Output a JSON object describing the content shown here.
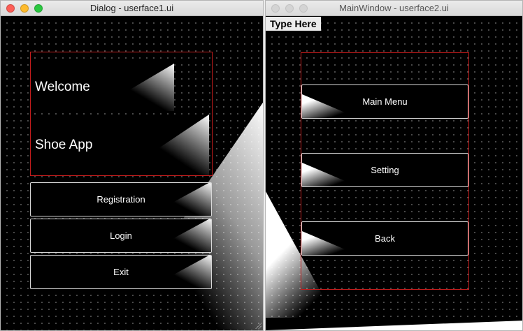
{
  "colors": {
    "close": "#fd5e56",
    "minimize": "#febb2d",
    "zoom": "#2ac840",
    "layout_border": "#c41c1c"
  },
  "dialog": {
    "title": "Dialog - userface1.ui",
    "labels": {
      "welcome": "Welcome",
      "shoe_app": "Shoe App"
    },
    "buttons": {
      "registration": "Registration",
      "login": "Login",
      "exit": "Exit"
    }
  },
  "main_window": {
    "title": "MainWindow - userface2.ui",
    "menu": {
      "type_here": "Type Here"
    },
    "buttons": {
      "main_menu": "Main Menu",
      "setting": "Setting",
      "back": "Back"
    }
  }
}
